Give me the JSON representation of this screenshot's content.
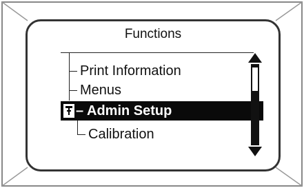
{
  "screen": {
    "title": "Functions",
    "items": [
      {
        "label": "Print Information",
        "selected": false
      },
      {
        "label": "Menus",
        "selected": false
      },
      {
        "label": "Admin Setup",
        "selected": true,
        "prefix": "–",
        "icon": "lock-icon"
      },
      {
        "label": "Calibration",
        "selected": false
      }
    ],
    "scrollbar": {
      "up_icon": "arrow-up-icon",
      "down_icon": "arrow-down-icon"
    }
  },
  "colors": {
    "foreground": "#111111",
    "highlight": "#0a0a0a",
    "background": "#ffffff"
  }
}
